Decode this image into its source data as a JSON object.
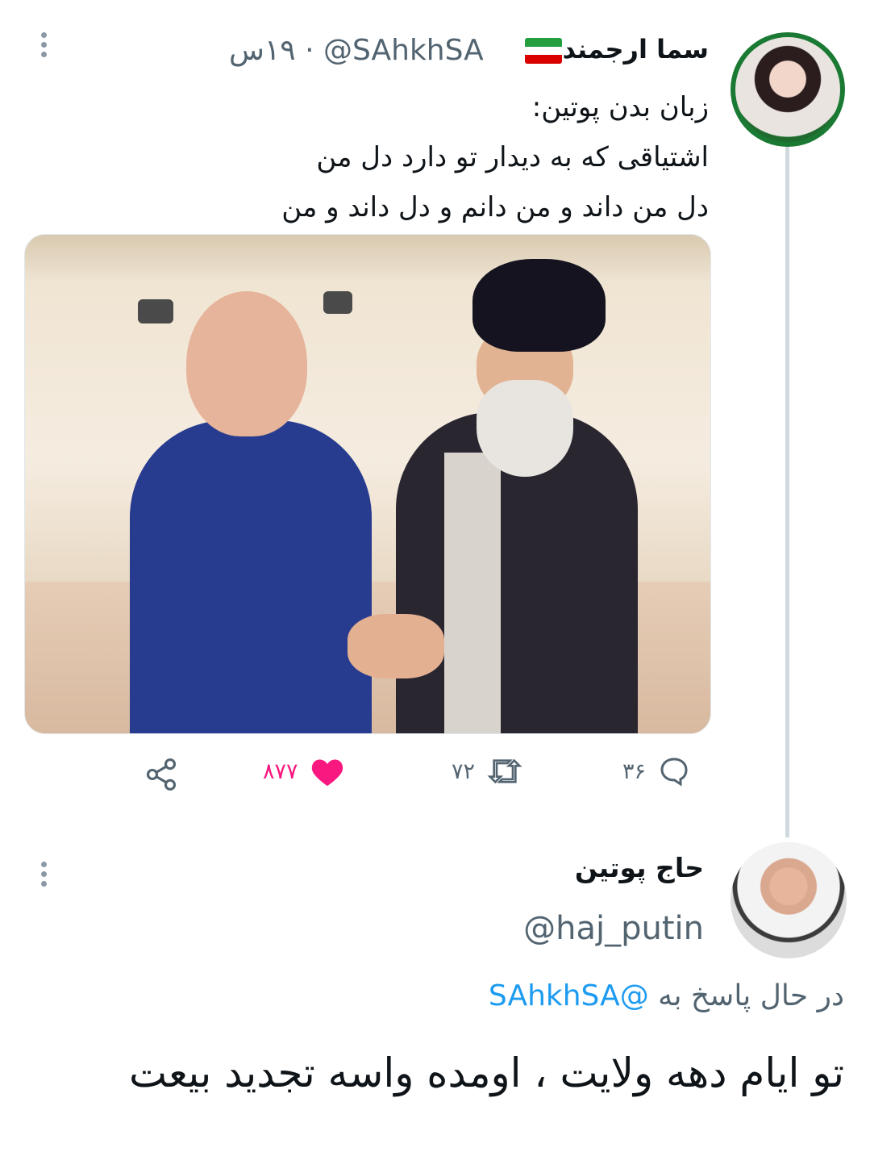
{
  "colors": {
    "accent": "#1d9bf0",
    "like": "#f91880",
    "secondary_text": "#536471",
    "thread_line": "#cfd9de"
  },
  "tweet1": {
    "display_name": "سما ارجمند",
    "handle": "@SAhkhSA",
    "separator": "·",
    "time": "۱۹س",
    "lines": [
      "زبان بدن پوتین:",
      "اشتیاقی که به دیدار تو دارد دل من",
      "دل من داند و من دانم و دل داند و من"
    ],
    "actions": {
      "reply_count": "۳۶",
      "retweet_count": "۷۲",
      "like_count": "۸۷۷"
    },
    "icons": {
      "flag": "iran-flag-icon",
      "reply": "reply-icon",
      "retweet": "retweet-icon",
      "like": "heart-filled-icon",
      "share": "share-icon",
      "more": "more-icon"
    }
  },
  "tweet2": {
    "display_name": "حاج پوتین",
    "handle": "@haj_putin",
    "replying_prefix": "در حال پاسخ به",
    "replying_to": "@SAhkhSA",
    "text": "تو ایام دهه ولایت ، اومده واسه تجدید بیعت"
  }
}
